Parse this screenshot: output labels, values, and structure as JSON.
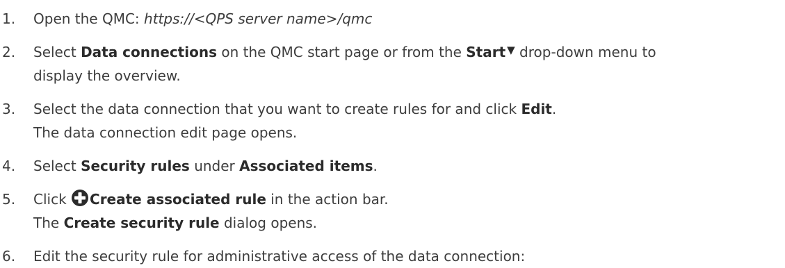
{
  "steps": [
    {
      "number": "1.",
      "line1": {
        "pre": "Open the QMC: ",
        "url": "https://<QPS server name>/qmc"
      }
    },
    {
      "number": "2.",
      "line1": {
        "pre": "Select ",
        "bold1": "Data connections",
        "mid": " on the QMC start page or from the ",
        "bold2": "Start",
        "post": " drop-down menu to"
      },
      "line2": "display the overview."
    },
    {
      "number": "3.",
      "line1": {
        "pre": "Select the data connection that you want to create rules for and click ",
        "bold": "Edit",
        "post": "."
      },
      "line2": "The data connection edit page opens."
    },
    {
      "number": "4.",
      "line1": {
        "pre": "Select ",
        "bold1": "Security rules",
        "mid": " under ",
        "bold2": "Associated items",
        "post": "."
      }
    },
    {
      "number": "5.",
      "line1": {
        "pre": "Click ",
        "bold": "Create associated rule",
        "post": " in the action bar."
      },
      "line2": {
        "pre": "The ",
        "bold": "Create security rule",
        "post": " dialog opens."
      }
    },
    {
      "number": "6.",
      "line1": {
        "text": "Edit the security rule for administrative access of the data connection:"
      }
    }
  ],
  "icons": {
    "dropdown": "caret-down-icon",
    "create": "plus-circle-icon"
  },
  "glyphs": {
    "caret": "▼"
  }
}
